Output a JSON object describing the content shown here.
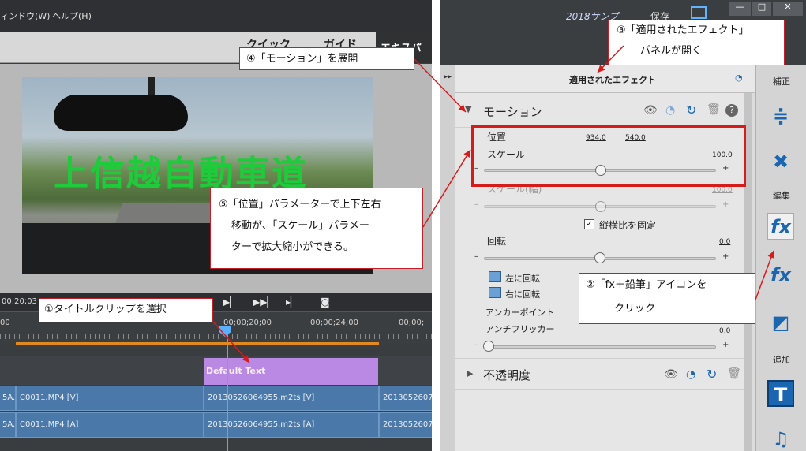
{
  "left": {
    "menu": [
      "ィンドウ(W)",
      "ヘルプ(H)"
    ],
    "tabs": [
      "クイック",
      "ガイド",
      "エキスパー"
    ],
    "video_title": "上信越自動車道",
    "timecode": "00;20;03",
    "ruler_labels": [
      "00",
      "00;00;20;00",
      "00;00;24;00",
      "00;00;"
    ],
    "title_clip": "Default Text",
    "video_clips": [
      "5A.",
      "C0011.MP4 [V]",
      "20130526064955.m2ts [V]",
      "2013052607"
    ],
    "audio_clips": [
      "5A.",
      "C0011.MP4 [A]",
      "20130526064955.m2ts [A]",
      "2013052607"
    ]
  },
  "right": {
    "top_text": "2018サンプ",
    "save_label": "保存",
    "applied_title": "適用されたエフェクト",
    "motion_label": "モーション",
    "position_label": "位置",
    "pos_x": "934.0",
    "pos_y": "540.0",
    "scale_label": "スケール",
    "scale_value": "100.0",
    "scale_w_label": "スケール(幅)",
    "scale_w_value": "100.0",
    "aspect_label": "縦横比を固定",
    "rotation_label": "回転",
    "rotation_value": "0.0",
    "rot_left": "左に回転",
    "rot_right": "右に回転",
    "anchor_label": "アンカーポイント",
    "antiflicker_label": "アンチフリッカー",
    "antiflicker_value": "0.0",
    "opacity_label": "不透明度",
    "sidebar": {
      "label_correct": "補正",
      "label_edit": "編集",
      "label_add": "追加"
    }
  },
  "callouts": {
    "c1": "①タイトルクリップを選択",
    "c2_line1": "②「fx＋鉛筆」アイコンを",
    "c2_line2": "クリック",
    "c3_line1": "③「適用されたエフェクト」",
    "c3_line2": "パネルが開く",
    "c4": "④「モーション」を展開",
    "c5_line1": "⑤「位置」パラメーターで上下左右",
    "c5_line2": "移動が、「スケール」パラメー",
    "c5_line3": "ターで拡大縮小ができる。"
  }
}
